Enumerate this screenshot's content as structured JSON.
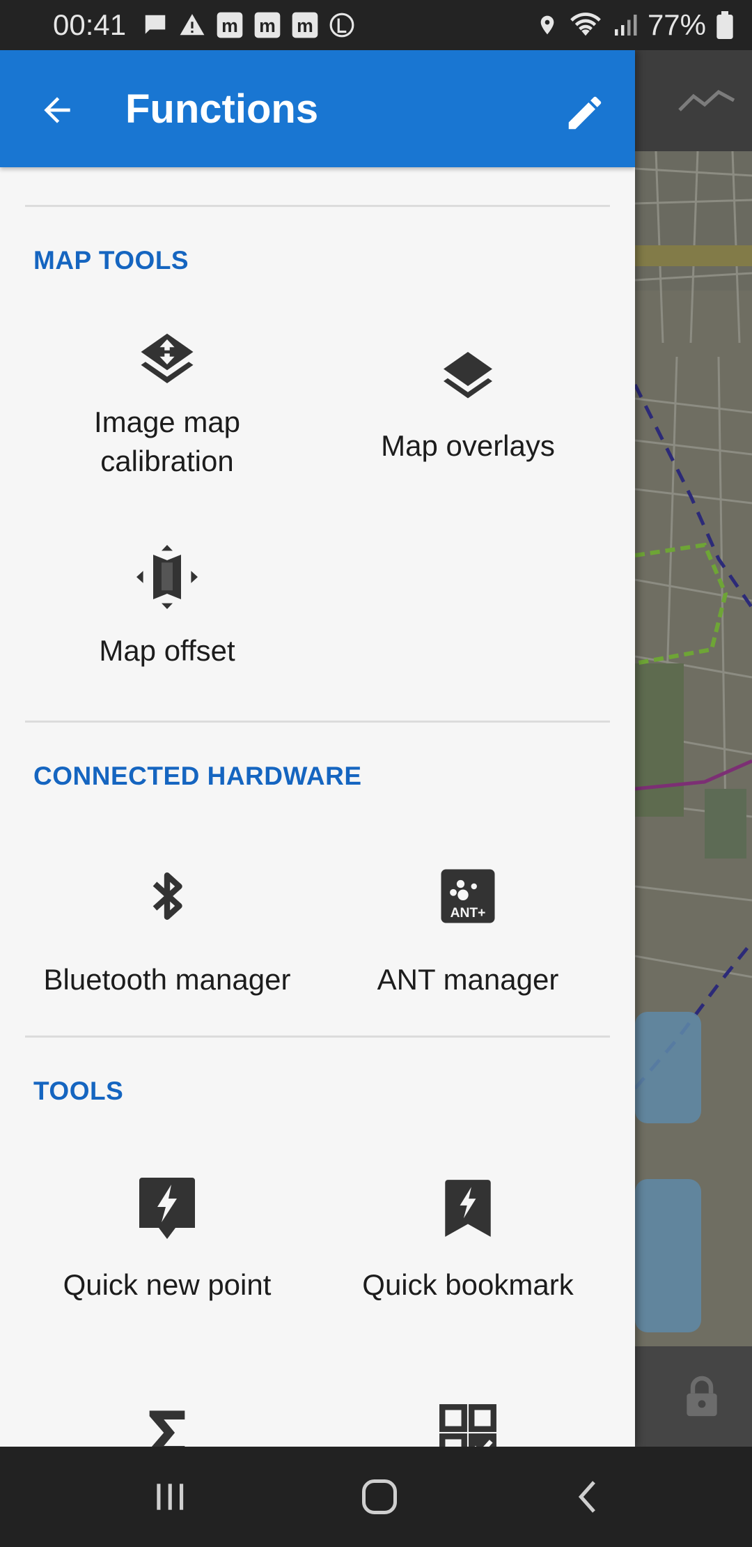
{
  "status_bar": {
    "time": "00:41",
    "battery_percent": "77%",
    "left_icons": [
      "chat-icon",
      "warning-icon",
      "m-notification-icon",
      "m-notification-icon",
      "m-notification-icon",
      "l-circle-icon"
    ],
    "right_icons": [
      "location-icon",
      "wifi-icon",
      "signal-icon",
      "battery-icon"
    ]
  },
  "app_bar": {
    "title": "Functions",
    "back_icon": "arrow-back-icon",
    "edit_icon": "pencil-icon",
    "color": "#1976d2"
  },
  "sections": [
    {
      "title": "MAP TOOLS",
      "items": [
        {
          "label": "Image map calibration",
          "icon": "layers-calibration-icon"
        },
        {
          "label": "Map overlays",
          "icon": "layers-icon"
        },
        {
          "label": "Map offset",
          "icon": "map-offset-icon"
        }
      ]
    },
    {
      "title": "CONNECTED HARDWARE",
      "items": [
        {
          "label": "Bluetooth manager",
          "icon": "bluetooth-icon"
        },
        {
          "label": "ANT manager",
          "icon": "ant-plus-icon",
          "icon_text": "ANT+"
        }
      ]
    },
    {
      "title": "TOOLS",
      "items": [
        {
          "label": "Quick new point",
          "icon": "quick-point-icon"
        },
        {
          "label": "Quick bookmark",
          "icon": "quick-bookmark-icon"
        },
        {
          "label": "",
          "icon": "sigma-icon"
        },
        {
          "label": "",
          "icon": "qr-code-icon"
        }
      ]
    }
  ],
  "nav_bar": {
    "buttons": [
      "recent-apps-icon",
      "home-icon",
      "back-icon"
    ]
  },
  "accent_color": "#1565c0"
}
